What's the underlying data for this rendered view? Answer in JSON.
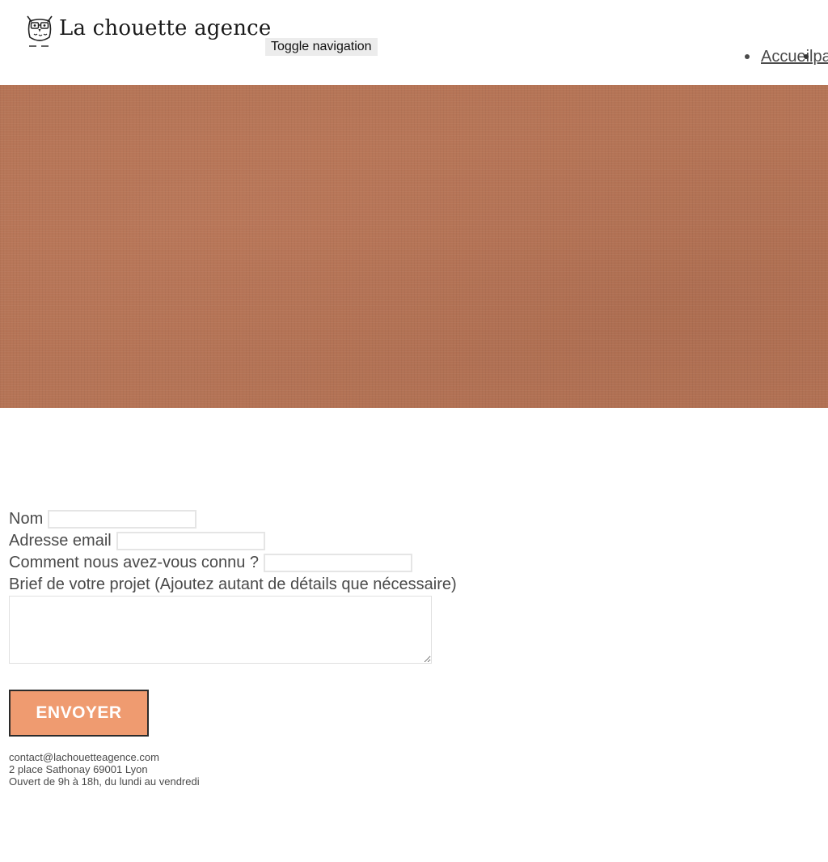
{
  "header": {
    "brand_name": "La chouette agence",
    "toggle_label": "Toggle navigation",
    "nav_items": [
      {
        "label": "Accueilpa"
      }
    ]
  },
  "hero": {
    "background_color": "#b57456"
  },
  "form": {
    "name_label": "Nom",
    "name_value": "",
    "email_label": "Adresse email",
    "email_value": "",
    "source_label": "Comment nous avez-vous connu ?",
    "source_value": "",
    "brief_label": "Brief de votre projet (Ajoutez autant de détails que nécessaire)",
    "brief_value": "",
    "submit_label": "ENVOYER",
    "submit_color": "#ef9b70"
  },
  "footer": {
    "email": "contact@lachouetteagence.com",
    "address": "2 place Sathonay 69001 Lyon",
    "hours": "Ouvert de 9h à 18h, du lundi au vendredi"
  }
}
